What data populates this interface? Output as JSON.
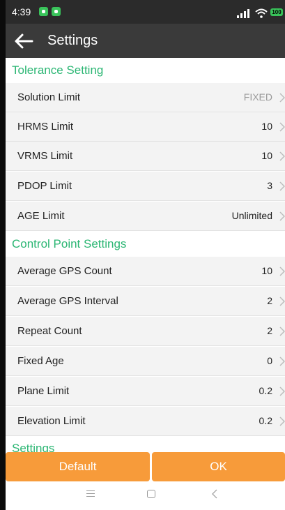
{
  "status_bar": {
    "time": "4:39",
    "battery": "100"
  },
  "app_bar": {
    "title": "Settings"
  },
  "sections": {
    "tolerance": "Tolerance Setting",
    "control_point": "Control Point Settings",
    "settings": "Settings"
  },
  "tolerance_rows": [
    {
      "label": "Solution Limit",
      "value": "FIXED"
    },
    {
      "label": "HRMS Limit",
      "value": "10"
    },
    {
      "label": "VRMS Limit",
      "value": "10"
    },
    {
      "label": "PDOP Limit",
      "value": "3"
    },
    {
      "label": "AGE Limit",
      "value": "Unlimited"
    }
  ],
  "control_rows": [
    {
      "label": "Average GPS Count",
      "value": "10"
    },
    {
      "label": "Average GPS Interval",
      "value": "2"
    },
    {
      "label": "Repeat Count",
      "value": "2"
    },
    {
      "label": "Fixed Age",
      "value": "0"
    },
    {
      "label": "Plane Limit",
      "value": "0.2"
    },
    {
      "label": "Elevation Limit",
      "value": "0.2"
    }
  ],
  "buttons": {
    "default": "Default",
    "ok": "OK"
  },
  "icons": {
    "back": "back-arrow-icon",
    "chevron": "chevron-right-icon",
    "nav_menu": "menu-icon",
    "nav_home": "home-icon",
    "nav_back": "nav-back-icon"
  },
  "colors": {
    "accent_green": "#2bb673",
    "button_orange": "#f79b3a",
    "appbar": "#3a3a3a"
  }
}
